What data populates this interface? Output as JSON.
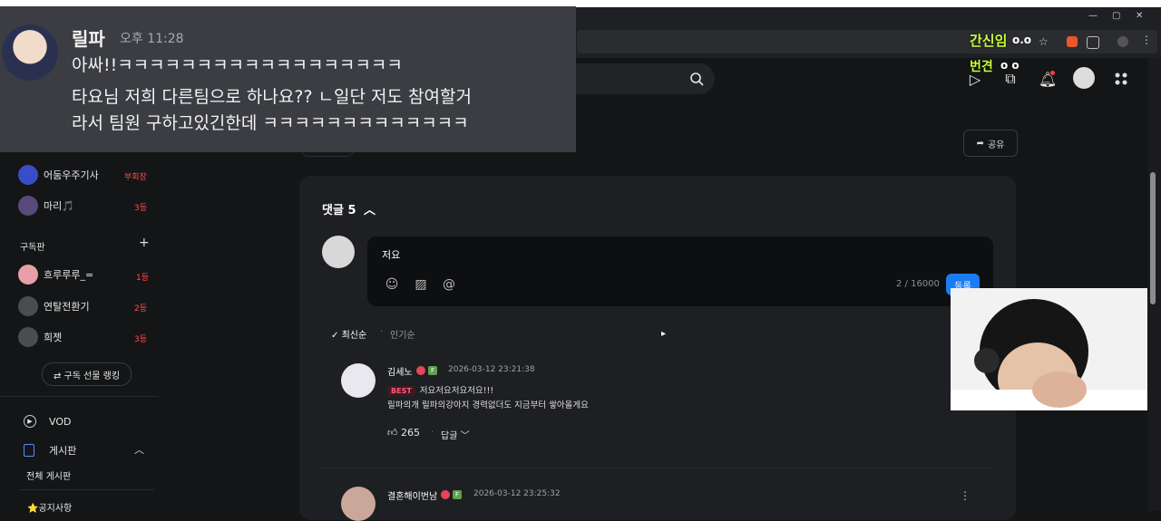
{
  "colors": {
    "accent": "#1a7cf5",
    "badge_red": "#ff4d4d",
    "best_pink": "#ff5b7a",
    "overlay_green": "#c8ff3a"
  },
  "browser": {
    "overlay_text_1": "간신임",
    "overlay_text_2": "번견",
    "overlay_circles_1": "o.o",
    "overlay_circles_2": "o o"
  },
  "chat": {
    "username": "릴파",
    "time": "오후 11:28",
    "line1": "아싸!!ㅋㅋㅋㅋㅋㅋㅋㅋㅋㅋㅋㅋㅋㅋㅋㅋㅋㅋ",
    "line2": "타요님 저희 다른팀으로 하나요?? ㄴ일단 저도 참여할거",
    "line3": "라서 팀원 구하고있긴한데 ㅋㅋㅋㅋㅋㅋㅋㅋㅋㅋㅋㅋㅋ"
  },
  "sidebar": {
    "members": [
      {
        "name": "어둠우주기사",
        "badge": "부회장"
      },
      {
        "name": "마리🎵",
        "badge": "3등"
      }
    ],
    "subscription_title": "구독판",
    "subscribers": [
      {
        "name": "흐루루루_=",
        "badge": "1등"
      },
      {
        "name": "연탈전환기",
        "badge": "2등"
      },
      {
        "name": "희젯",
        "badge": "3등"
      }
    ],
    "rank_button": "⇄ 구독 선물 랭킹",
    "vod": "VOD",
    "board": "게시판",
    "board_all": "전체 게시판",
    "notice": "⭐공지사항"
  },
  "main": {
    "share": "공유",
    "comments_title": "댓글 5",
    "composer_text": "저요",
    "char_count": "2 / 16000",
    "submit": "등록",
    "sort_latest": "최신순",
    "sort_popular": "인기순"
  },
  "comments": [
    {
      "name": "김세노",
      "date": "2026-03-12 23:21:38",
      "best": "BEST",
      "line1": "저요저요저요저요!!!",
      "line2": "릴파의개 릴파의강아지 경력없더도 지금부터 쌓아올게요",
      "likes": "265",
      "reply": "답글"
    },
    {
      "name": "결혼해이번남",
      "date": "2026-03-12 23:25:32"
    }
  ]
}
